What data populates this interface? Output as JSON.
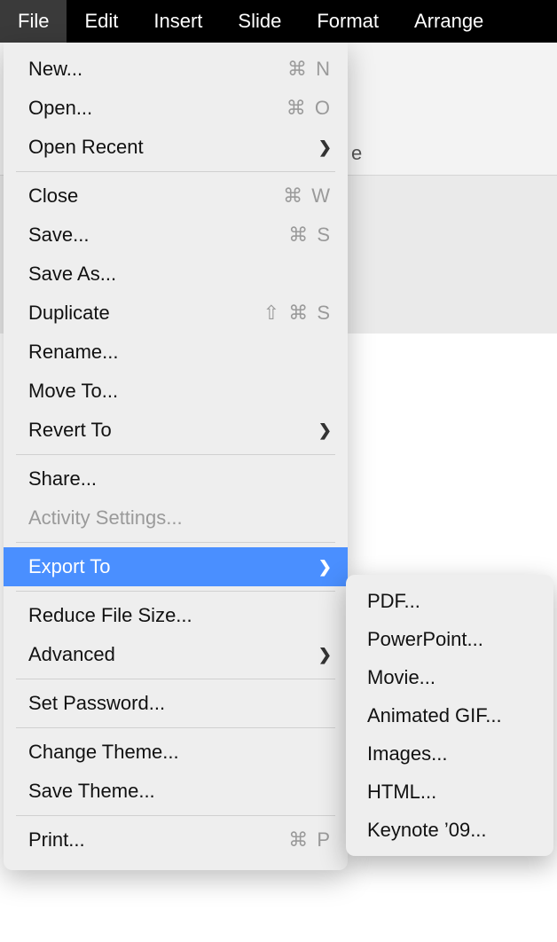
{
  "menubar": {
    "items": [
      {
        "label": "File",
        "active": true
      },
      {
        "label": "Edit",
        "active": false
      },
      {
        "label": "Insert",
        "active": false
      },
      {
        "label": "Slide",
        "active": false
      },
      {
        "label": "Format",
        "active": false
      },
      {
        "label": "Arrange",
        "active": false
      }
    ]
  },
  "background": {
    "hint_char": "e"
  },
  "file_menu": {
    "new": "New...",
    "new_sc": "⌘ N",
    "open": "Open...",
    "open_sc": "⌘ O",
    "open_recent": "Open Recent",
    "close": "Close",
    "close_sc": "⌘ W",
    "save": "Save...",
    "save_sc": "⌘ S",
    "save_as": "Save As...",
    "duplicate": "Duplicate",
    "duplicate_sc": "⇧ ⌘ S",
    "rename": "Rename...",
    "move_to": "Move To...",
    "revert_to": "Revert To",
    "share": "Share...",
    "activity_settings": "Activity Settings...",
    "export_to": "Export To",
    "reduce_file_size": "Reduce File Size...",
    "advanced": "Advanced",
    "set_password": "Set Password...",
    "change_theme": "Change Theme...",
    "save_theme": "Save Theme...",
    "print": "Print...",
    "print_sc": "⌘ P"
  },
  "export_submenu": {
    "pdf": "PDF...",
    "powerpoint": "PowerPoint...",
    "movie": "Movie...",
    "animated_gif": "Animated GIF...",
    "images": "Images...",
    "html": "HTML...",
    "keynote09": "Keynote ’09..."
  }
}
